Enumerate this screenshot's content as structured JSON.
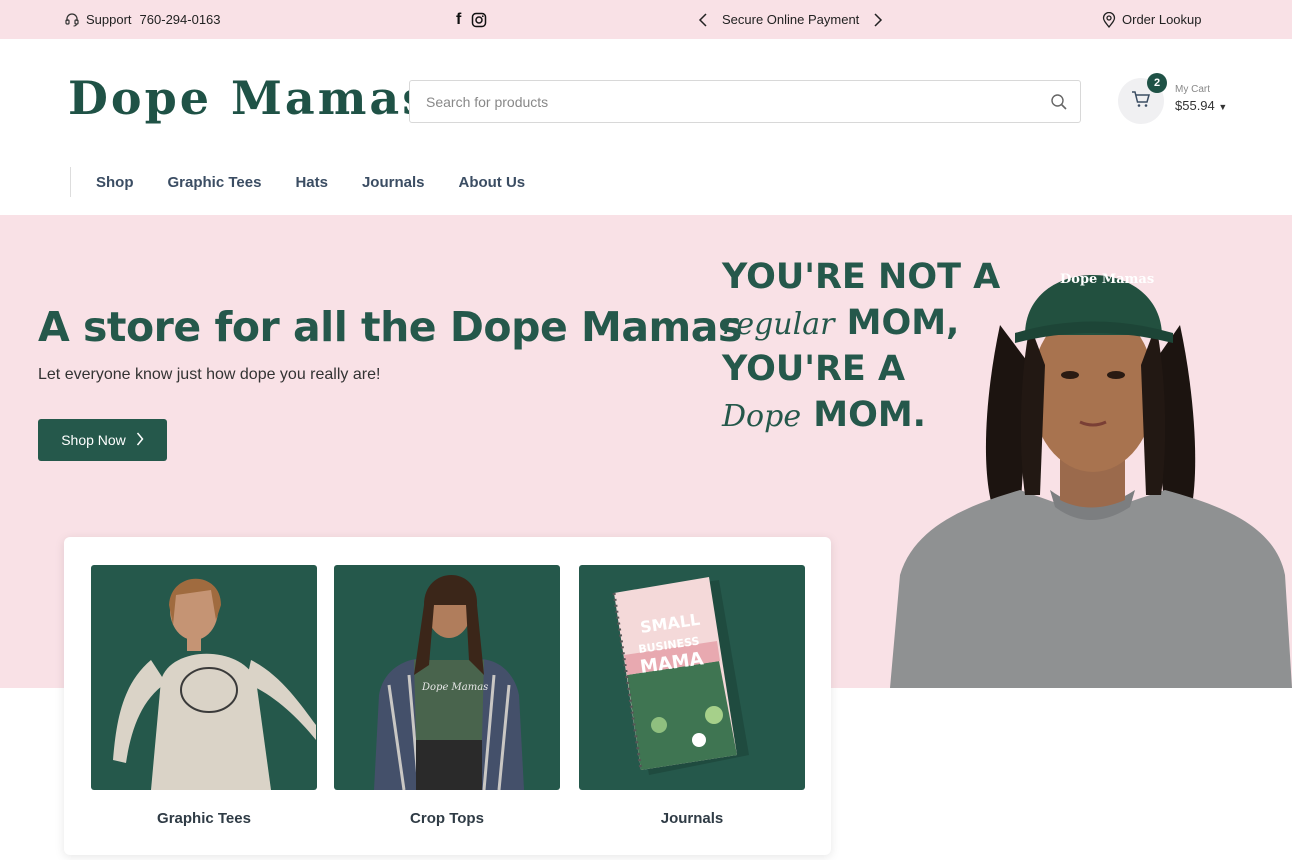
{
  "topbar": {
    "support_label": "Support",
    "support_phone": "760-294-0163",
    "payment_label": "Secure Online Payment",
    "order_lookup": "Order Lookup",
    "social": [
      "facebook-icon",
      "instagram-icon"
    ]
  },
  "header": {
    "logo_text": "Dope Mamas",
    "search_placeholder": "Search for products",
    "cart": {
      "count": "2",
      "label": "My Cart",
      "total": "$55.94"
    }
  },
  "nav": {
    "items": [
      "Shop",
      "Graphic Tees",
      "Hats",
      "Journals",
      "About Us"
    ]
  },
  "hero": {
    "title": "A store for all the Dope Mamas",
    "subtitle": "Let everyone know just how dope you really are!",
    "cta": "Shop Now",
    "slogan": {
      "line1": "YOU'RE NOT A",
      "line2_script": "regular",
      "line2": "MOM,",
      "line3": "YOU'RE A",
      "line4_script": "Dope",
      "line4": "MOM."
    },
    "hat_text": "Dope Mamas"
  },
  "categories": [
    {
      "name": "Graphic Tees"
    },
    {
      "name": "Crop Tops"
    },
    {
      "name": "Journals"
    }
  ],
  "colors": {
    "brand_green": "#25584b",
    "pink": "#f9e1e6"
  }
}
